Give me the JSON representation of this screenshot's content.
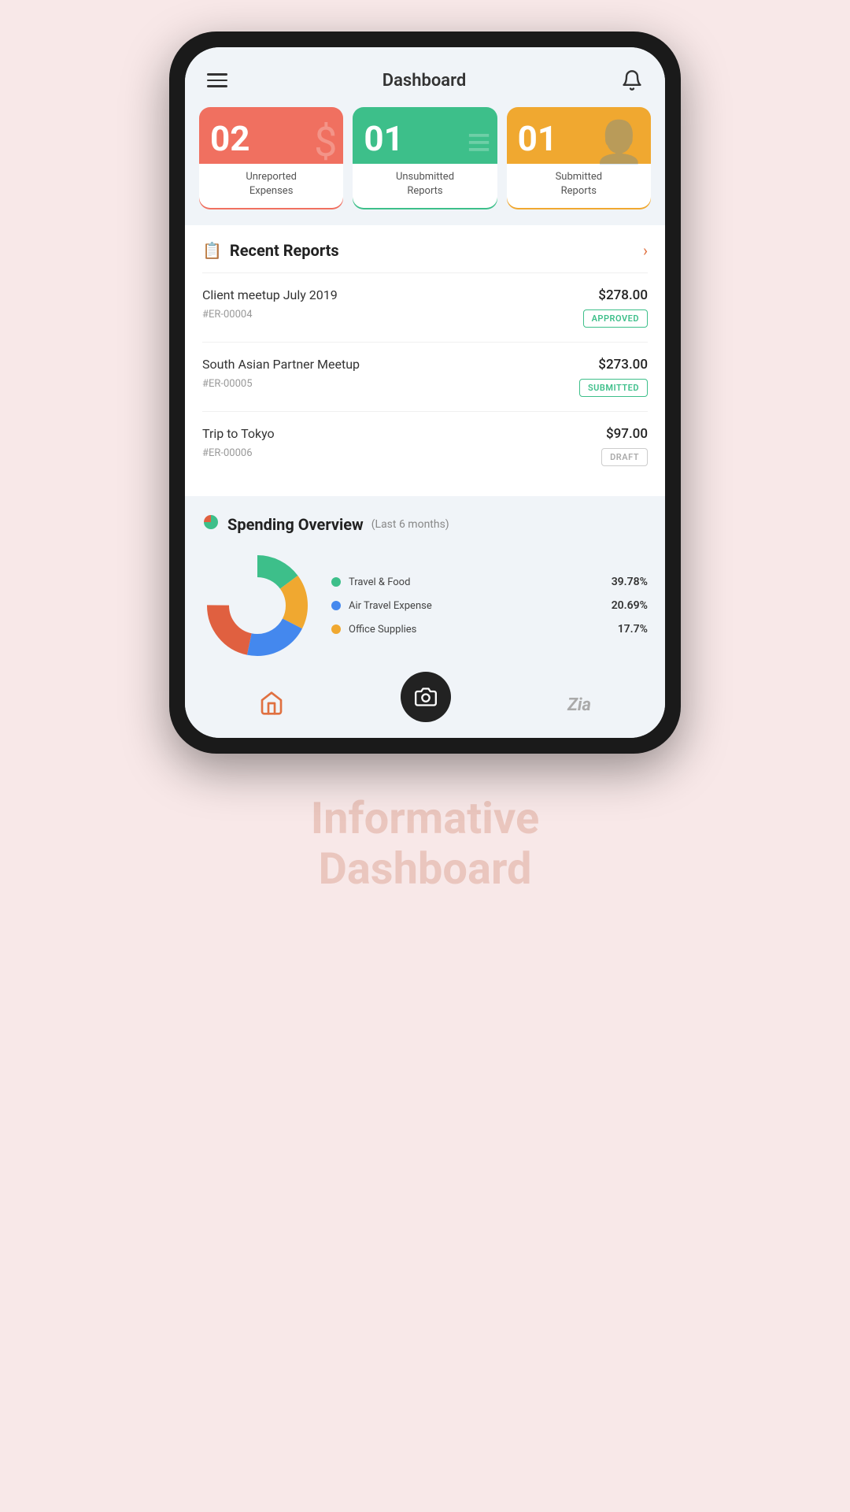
{
  "header": {
    "title": "Dashboard",
    "bell_label": "notifications"
  },
  "summary_cards": [
    {
      "number": "02",
      "label": "Unreported\nExpenses",
      "color": "red",
      "icon": "$"
    },
    {
      "number": "01",
      "label": "Unsubmitted\nReports",
      "color": "green",
      "icon": "≡"
    },
    {
      "number": "01",
      "label": "Submitted\nReports",
      "color": "orange",
      "icon": "👤"
    }
  ],
  "recent_reports": {
    "title": "Recent Reports",
    "items": [
      {
        "name": "Client meetup July 2019",
        "id": "#ER-00004",
        "amount": "$278.00",
        "status": "APPROVED",
        "status_type": "approved"
      },
      {
        "name": "South Asian Partner Meetup",
        "id": "#ER-00005",
        "amount": "$273.00",
        "status": "SUBMITTED",
        "status_type": "submitted"
      },
      {
        "name": "Trip to Tokyo",
        "id": "#ER-00006",
        "amount": "$97.00",
        "status": "DRAFT",
        "status_type": "draft"
      }
    ]
  },
  "spending_overview": {
    "title": "Spending Overview",
    "subtitle": "(Last 6 months)",
    "legend": [
      {
        "label": "Travel & Food",
        "percent": "39.78%",
        "color": "#3dbf8a",
        "value": 39.78
      },
      {
        "label": "Air Travel Expense",
        "percent": "20.69%",
        "color": "#4488ee",
        "value": 20.69
      },
      {
        "label": "Office Supplies",
        "percent": "17.7%",
        "color": "#f0a830",
        "value": 17.7
      }
    ],
    "other_color": "#e06040",
    "other_value": 21.83
  },
  "bottom_nav": {
    "home_label": "Home",
    "camera_label": "Camera",
    "zia_label": "Zia"
  },
  "bottom_text": {
    "line1": "Informative",
    "line2": "Dashboard"
  }
}
